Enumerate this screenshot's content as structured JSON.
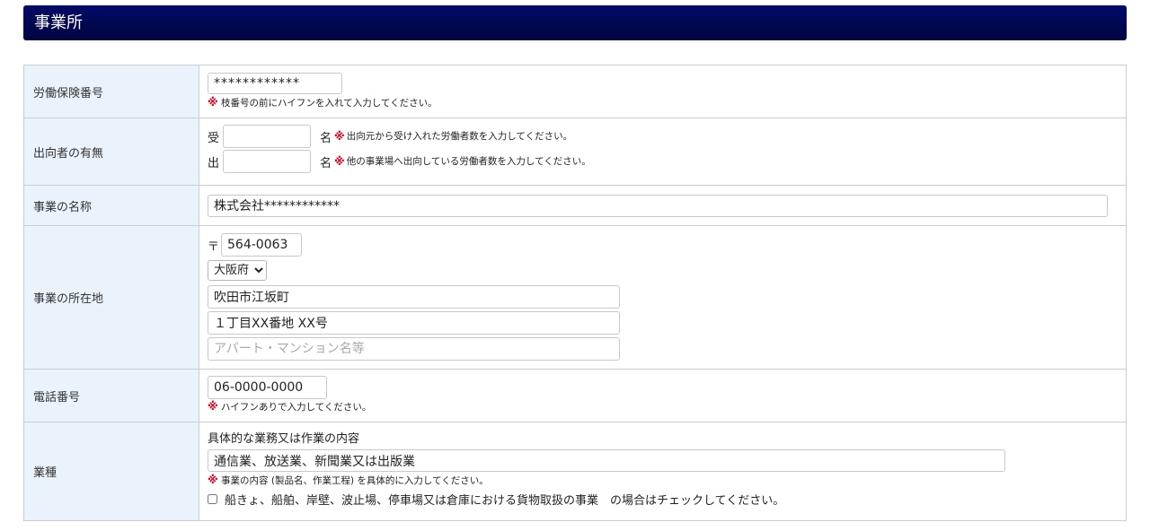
{
  "section": {
    "title": "事業所"
  },
  "note_mark": "※",
  "fields": {
    "insurance_number": {
      "label": "労働保険番号",
      "value": "************",
      "note": "枝番号の前にハイフンを入れて入力してください。"
    },
    "secondment": {
      "label": "出向者の有無",
      "receive_label": "受",
      "receive_value": "",
      "send_label": "出",
      "send_value": "",
      "unit": "名",
      "receive_note": "出向元から受け入れた労働者数を入力してください。",
      "send_note": "他の事業場へ出向している労働者数を入力してください。"
    },
    "business_name": {
      "label": "事業の名称",
      "value": "株式会社************"
    },
    "address": {
      "label": "事業の所在地",
      "postal_mark": "〒",
      "postal_value": "564-0063",
      "prefecture": "大阪府",
      "city": "吹田市江坂町",
      "street": "１丁目XX番地 XX号",
      "building_value": "",
      "building_placeholder": "アパート・マンション名等"
    },
    "phone": {
      "label": "電話番号",
      "value": "06-0000-0000",
      "note": "ハイフンありで入力してください。"
    },
    "industry": {
      "label": "業種",
      "sub_label": "具体的な業務又は作業の内容",
      "value": "通信業、放送業、新聞業又は出版業",
      "note": "事業の内容 (製品名、作業工程) を具体的に入力してください。",
      "checkbox_label": "船きょ、船舶、岸壁、波止場、停車場又は倉庫における貨物取扱の事業　の場合はチェックしてください。",
      "checkbox_checked": false
    }
  }
}
